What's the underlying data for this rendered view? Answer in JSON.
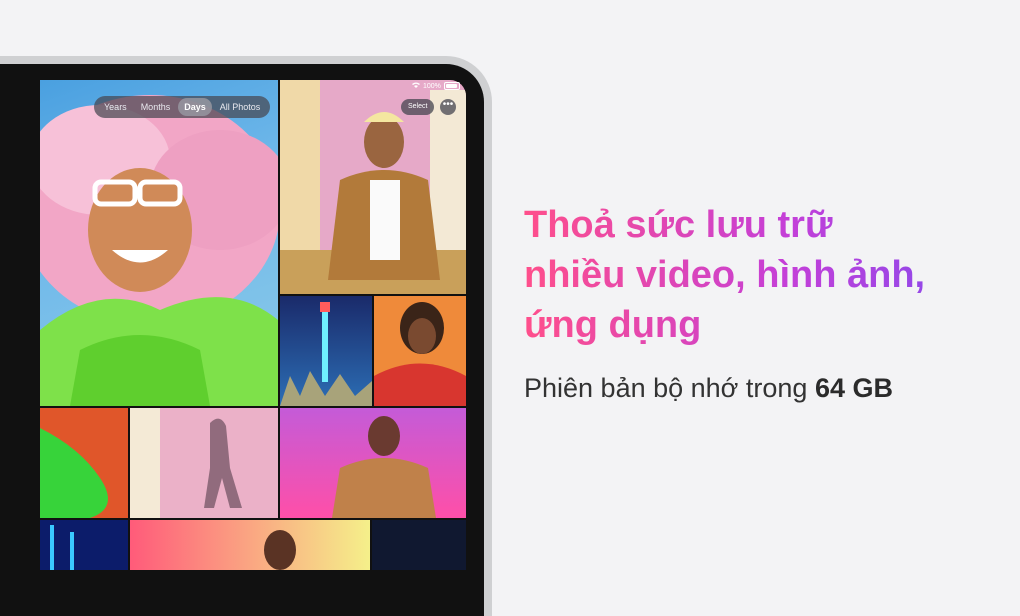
{
  "photos_app": {
    "view_tabs": [
      "Years",
      "Months",
      "Days",
      "All Photos"
    ],
    "active_tab": "Days",
    "battery_text": "100%",
    "select_label": "Select",
    "more_label": "•••"
  },
  "promo": {
    "headline_lines": [
      "Thoả sức lưu trữ",
      "nhiều video, hình ảnh,",
      "ứng dụng"
    ],
    "subline_prefix": "Phiên bản bộ nhớ trong ",
    "subline_capacity": "64 GB"
  },
  "colors": {
    "headline_gradient": [
      "#ff4f8b",
      "#c43fd8",
      "#7b4cf0"
    ],
    "background": "#f3f3f5"
  }
}
